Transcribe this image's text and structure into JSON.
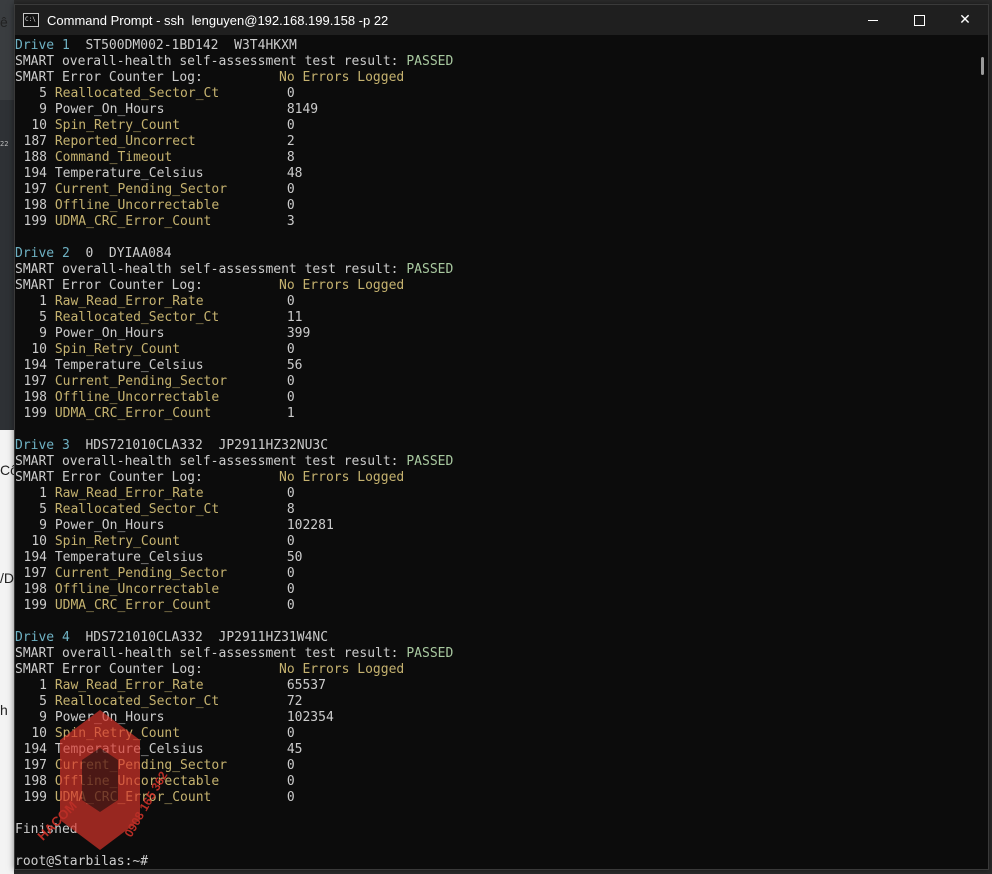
{
  "window": {
    "title": "Command Prompt - ssh  lenguyen@192.168.199.158 -p 22",
    "controls": {
      "minimize": "—",
      "maximize": "□",
      "close": "✕"
    }
  },
  "background_fragments": [
    "ê",
    "Cô",
    "/D",
    "h",
    "22"
  ],
  "drives": [
    {
      "label": "Drive 1",
      "info": "  ST500DM002-1BD142  W3T4HKXM",
      "overall": "SMART overall-health self-assessment test result: ",
      "result": "PASSED",
      "log_label": "SMART Error Counter Log:",
      "log_value": "No Errors Logged",
      "attributes": [
        {
          "id": "5",
          "name": "Reallocated_Sector_Ct",
          "value": "0",
          "highlight": true
        },
        {
          "id": "9",
          "name": "Power_On_Hours",
          "value": "8149",
          "highlight": false
        },
        {
          "id": "10",
          "name": "Spin_Retry_Count",
          "value": "0",
          "highlight": true
        },
        {
          "id": "187",
          "name": "Reported_Uncorrect",
          "value": "2",
          "highlight": true
        },
        {
          "id": "188",
          "name": "Command_Timeout",
          "value": "8",
          "highlight": true
        },
        {
          "id": "194",
          "name": "Temperature_Celsius",
          "value": "48",
          "highlight": false
        },
        {
          "id": "197",
          "name": "Current_Pending_Sector",
          "value": "0",
          "highlight": true
        },
        {
          "id": "198",
          "name": "Offline_Uncorrectable",
          "value": "0",
          "highlight": true
        },
        {
          "id": "199",
          "name": "UDMA_CRC_Error_Count",
          "value": "3",
          "highlight": true
        }
      ]
    },
    {
      "label": "Drive 2",
      "info": "  0  DYIAA084",
      "overall": "SMART overall-health self-assessment test result: ",
      "result": "PASSED",
      "log_label": "SMART Error Counter Log:",
      "log_value": "No Errors Logged",
      "attributes": [
        {
          "id": "1",
          "name": "Raw_Read_Error_Rate",
          "value": "0",
          "highlight": true
        },
        {
          "id": "5",
          "name": "Reallocated_Sector_Ct",
          "value": "11",
          "highlight": true
        },
        {
          "id": "9",
          "name": "Power_On_Hours",
          "value": "399",
          "highlight": false
        },
        {
          "id": "10",
          "name": "Spin_Retry_Count",
          "value": "0",
          "highlight": true
        },
        {
          "id": "194",
          "name": "Temperature_Celsius",
          "value": "56",
          "highlight": false
        },
        {
          "id": "197",
          "name": "Current_Pending_Sector",
          "value": "0",
          "highlight": true
        },
        {
          "id": "198",
          "name": "Offline_Uncorrectable",
          "value": "0",
          "highlight": true
        },
        {
          "id": "199",
          "name": "UDMA_CRC_Error_Count",
          "value": "1",
          "highlight": true
        }
      ]
    },
    {
      "label": "Drive 3",
      "info": "  HDS721010CLA332  JP2911HZ32NU3C",
      "overall": "SMART overall-health self-assessment test result: ",
      "result": "PASSED",
      "log_label": "SMART Error Counter Log:",
      "log_value": "No Errors Logged",
      "attributes": [
        {
          "id": "1",
          "name": "Raw_Read_Error_Rate",
          "value": "0",
          "highlight": true
        },
        {
          "id": "5",
          "name": "Reallocated_Sector_Ct",
          "value": "8",
          "highlight": true
        },
        {
          "id": "9",
          "name": "Power_On_Hours",
          "value": "102281",
          "highlight": false
        },
        {
          "id": "10",
          "name": "Spin_Retry_Count",
          "value": "0",
          "highlight": true
        },
        {
          "id": "194",
          "name": "Temperature_Celsius",
          "value": "50",
          "highlight": false
        },
        {
          "id": "197",
          "name": "Current_Pending_Sector",
          "value": "0",
          "highlight": true
        },
        {
          "id": "198",
          "name": "Offline_Uncorrectable",
          "value": "0",
          "highlight": true
        },
        {
          "id": "199",
          "name": "UDMA_CRC_Error_Count",
          "value": "0",
          "highlight": true
        }
      ]
    },
    {
      "label": "Drive 4",
      "info": "  HDS721010CLA332  JP2911HZ31W4NC",
      "overall": "SMART overall-health self-assessment test result: ",
      "result": "PASSED",
      "log_label": "SMART Error Counter Log:",
      "log_value": "No Errors Logged",
      "attributes": [
        {
          "id": "1",
          "name": "Raw_Read_Error_Rate",
          "value": "65537",
          "highlight": true
        },
        {
          "id": "5",
          "name": "Reallocated_Sector_Ct",
          "value": "72",
          "highlight": true
        },
        {
          "id": "9",
          "name": "Power_On_Hours",
          "value": "102354",
          "highlight": false
        },
        {
          "id": "10",
          "name": "Spin_Retry_Count",
          "value": "0",
          "highlight": true
        },
        {
          "id": "194",
          "name": "Temperature_Celsius",
          "value": "45",
          "highlight": false
        },
        {
          "id": "197",
          "name": "Current_Pending_Sector",
          "value": "0",
          "highlight": true
        },
        {
          "id": "198",
          "name": "Offline_Uncorrectable",
          "value": "0",
          "highlight": true
        },
        {
          "id": "199",
          "name": "UDMA_CRC_Error_Count",
          "value": "0",
          "highlight": true
        }
      ]
    }
  ],
  "footer": {
    "finished": "Finished",
    "prompt": "root@Starbilas:~#"
  },
  "watermark": {
    "brand": "HACOM",
    "phone": "0908 165 362",
    "colors": {
      "primary": "#d9342b"
    }
  },
  "colors": {
    "terminal_bg": "#0c0c0c",
    "text": "#cccccc",
    "yellow_attr": "#c5b26f",
    "drive_label": "#6fb2c4"
  }
}
